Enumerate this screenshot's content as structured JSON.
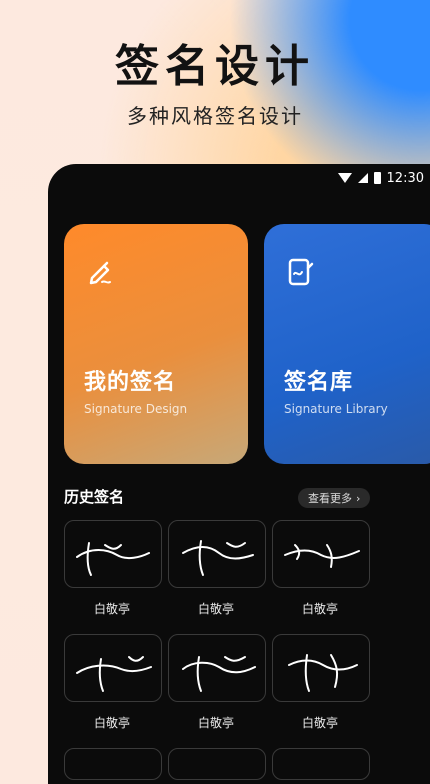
{
  "promo": {
    "title": "签名设计",
    "subtitle": "多种风格签名设计"
  },
  "status_bar": {
    "time": "12:30",
    "icons": [
      "wifi-icon",
      "signal-icon",
      "battery-icon"
    ]
  },
  "cards": {
    "my_signature": {
      "title": "我的签名",
      "subtitle": "Signature Design",
      "icon": "pen-edit-icon",
      "color_top": "#ff8a2a",
      "color_bottom": "#c7a878"
    },
    "signature_library": {
      "title": "签名库",
      "subtitle": "Signature Library",
      "icon": "tablet-pen-icon",
      "color_top": "#2f6fd8",
      "color_bottom": "#2a5aa8"
    }
  },
  "history": {
    "title": "历史签名",
    "more_label": "查看更多",
    "items": [
      {
        "name": "白敬亭"
      },
      {
        "name": "白敬亭"
      },
      {
        "name": "白敬亭"
      },
      {
        "name": "白敬亭"
      },
      {
        "name": "白敬亭"
      },
      {
        "name": "白敬亭"
      }
    ]
  }
}
